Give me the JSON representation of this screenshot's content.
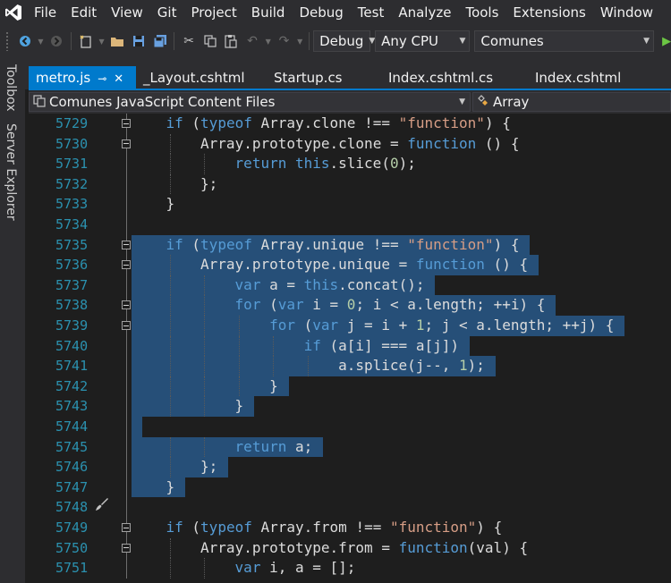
{
  "menu": {
    "items": [
      "File",
      "Edit",
      "View",
      "Git",
      "Project",
      "Build",
      "Debug",
      "Test",
      "Analyze",
      "Tools",
      "Extensions",
      "Window"
    ]
  },
  "toolbar": {
    "configuration": "Debug",
    "platform": "Any CPU",
    "project": "Comunes"
  },
  "side_tabs": {
    "toolbox": "Toolbox",
    "server_explorer": "Server Explorer"
  },
  "tabs": [
    {
      "label": "metro.js",
      "active": true
    },
    {
      "label": "_Layout.cshtml",
      "active": false
    },
    {
      "label": "Startup.cs",
      "active": false
    },
    {
      "label": "Index.cshtml.cs",
      "active": false
    },
    {
      "label": "Index.cshtml",
      "active": false
    }
  ],
  "navbar": {
    "project_scope": "Comunes JavaScript Content Files",
    "member": "Array"
  },
  "colors": {
    "accent": "#007acc",
    "selection": "#264f78",
    "keyword": "#569cd6",
    "string": "#d69d85",
    "number": "#b5cea8",
    "line_number": "#2b91af"
  },
  "code": {
    "lines": [
      {
        "num": "5729",
        "fold": true,
        "indent": 1,
        "tokens": [
          [
            "kw",
            "if"
          ],
          [
            "plain",
            " ("
          ],
          [
            "kw",
            "typeof"
          ],
          [
            "plain",
            " Array.clone !== "
          ],
          [
            "str",
            "\"function\""
          ],
          [
            "plain",
            ") {"
          ]
        ]
      },
      {
        "num": "5730",
        "fold": true,
        "indent": 2,
        "tokens": [
          [
            "plain",
            "Array.prototype.clone = "
          ],
          [
            "kw",
            "function"
          ],
          [
            "plain",
            " () {"
          ]
        ]
      },
      {
        "num": "5731",
        "fold": false,
        "indent": 3,
        "tokens": [
          [
            "kw",
            "return"
          ],
          [
            "plain",
            " "
          ],
          [
            "kw",
            "this"
          ],
          [
            "plain",
            ".slice("
          ],
          [
            "num",
            "0"
          ],
          [
            "plain",
            ");"
          ]
        ]
      },
      {
        "num": "5732",
        "fold": false,
        "indent": 2,
        "tokens": [
          [
            "plain",
            "};"
          ]
        ]
      },
      {
        "num": "5733",
        "fold": false,
        "indent": 1,
        "tokens": [
          [
            "plain",
            "}"
          ]
        ]
      },
      {
        "num": "5734",
        "fold": false,
        "indent": 0,
        "tokens": []
      },
      {
        "num": "5735",
        "fold": true,
        "indent": 1,
        "tokens": [
          [
            "kw",
            "if"
          ],
          [
            "plain",
            " ("
          ],
          [
            "kw",
            "typeof"
          ],
          [
            "plain",
            " Array.unique !== "
          ],
          [
            "str",
            "\"function\""
          ],
          [
            "plain",
            ") {"
          ]
        ]
      },
      {
        "num": "5736",
        "fold": true,
        "indent": 2,
        "tokens": [
          [
            "plain",
            "Array.prototype.unique = "
          ],
          [
            "kw",
            "function"
          ],
          [
            "plain",
            " () {"
          ]
        ]
      },
      {
        "num": "5737",
        "fold": false,
        "indent": 3,
        "tokens": [
          [
            "kw",
            "var"
          ],
          [
            "plain",
            " a = "
          ],
          [
            "kw",
            "this"
          ],
          [
            "plain",
            ".concat();"
          ]
        ]
      },
      {
        "num": "5738",
        "fold": true,
        "indent": 3,
        "tokens": [
          [
            "kw",
            "for"
          ],
          [
            "plain",
            " ("
          ],
          [
            "kw",
            "var"
          ],
          [
            "plain",
            " i = "
          ],
          [
            "num",
            "0"
          ],
          [
            "plain",
            "; i < a.length; ++i) {"
          ]
        ]
      },
      {
        "num": "5739",
        "fold": true,
        "indent": 4,
        "tokens": [
          [
            "kw",
            "for"
          ],
          [
            "plain",
            " ("
          ],
          [
            "kw",
            "var"
          ],
          [
            "plain",
            " j = i + "
          ],
          [
            "num",
            "1"
          ],
          [
            "plain",
            "; j < a.length; ++j) {"
          ]
        ]
      },
      {
        "num": "5740",
        "fold": false,
        "indent": 5,
        "tokens": [
          [
            "kw",
            "if"
          ],
          [
            "plain",
            " (a[i] === a[j])"
          ]
        ]
      },
      {
        "num": "5741",
        "fold": false,
        "indent": 6,
        "tokens": [
          [
            "plain",
            "a.splice(j--, "
          ],
          [
            "num",
            "1"
          ],
          [
            "plain",
            ");"
          ]
        ]
      },
      {
        "num": "5742",
        "fold": false,
        "indent": 4,
        "tokens": [
          [
            "plain",
            "}"
          ]
        ]
      },
      {
        "num": "5743",
        "fold": false,
        "indent": 3,
        "tokens": [
          [
            "plain",
            "}"
          ]
        ]
      },
      {
        "num": "5744",
        "fold": false,
        "indent": 0,
        "tokens": []
      },
      {
        "num": "5745",
        "fold": false,
        "indent": 3,
        "tokens": [
          [
            "kw",
            "return"
          ],
          [
            "plain",
            " a;"
          ]
        ]
      },
      {
        "num": "5746",
        "fold": false,
        "indent": 2,
        "tokens": [
          [
            "plain",
            "};"
          ]
        ]
      },
      {
        "num": "5747",
        "fold": false,
        "indent": 1,
        "tokens": [
          [
            "plain",
            "}"
          ]
        ]
      },
      {
        "num": "5748",
        "fold": false,
        "indent": 0,
        "tokens": [],
        "brush": true
      },
      {
        "num": "5749",
        "fold": true,
        "indent": 1,
        "tokens": [
          [
            "kw",
            "if"
          ],
          [
            "plain",
            " ("
          ],
          [
            "kw",
            "typeof"
          ],
          [
            "plain",
            " Array.from !== "
          ],
          [
            "str",
            "\"function\""
          ],
          [
            "plain",
            ") {"
          ]
        ]
      },
      {
        "num": "5750",
        "fold": true,
        "indent": 2,
        "tokens": [
          [
            "plain",
            "Array.prototype.from = "
          ],
          [
            "kw",
            "function"
          ],
          [
            "plain",
            "(val) {"
          ]
        ]
      },
      {
        "num": "5751",
        "fold": false,
        "indent": 3,
        "tokens": [
          [
            "kw",
            "var"
          ],
          [
            "plain",
            " i, a = [];"
          ]
        ]
      }
    ],
    "selected_range": [
      "5735",
      "5747"
    ]
  }
}
